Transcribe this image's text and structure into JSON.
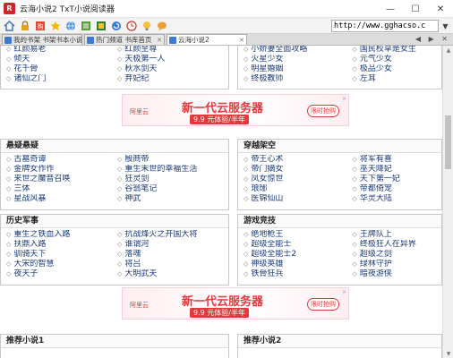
{
  "window": {
    "title": "云海小说2 TxT小说阅读器",
    "app_icon_letter": "R",
    "minimize": "—",
    "maximize": "☐",
    "close": "✕"
  },
  "toolbar": {
    "icons": [
      "home-icon",
      "lock-icon",
      "bookmark-icon",
      "star-icon",
      "globe-icon",
      "list-icon",
      "image-icon",
      "refresh-icon",
      "history-icon",
      "light-icon",
      "message-icon"
    ],
    "url": "http://www.gghacso.c",
    "go": "▼"
  },
  "tabs": [
    {
      "label": "我的书架 书架书本小说"
    },
    {
      "label": "热门频道 书库首页"
    },
    {
      "label": "云海小说2"
    }
  ],
  "tabbar_right": "◀ ▶ ✕",
  "sections": {
    "top": {
      "left": {
        "col1": [
          "红颜易老",
          "倾天",
          "花千骨",
          "诸仙之门"
        ],
        "col2": [
          "红颜至尊",
          "天极第一人",
          "秋水剑天",
          "弃妃纪"
        ]
      },
      "right": {
        "col1": [
          "小娇妻全面攻略",
          "火星少女",
          "明星婚姻",
          "终极教师"
        ],
        "col2": [
          "国民校草是女生",
          "元气少女",
          "极品少女",
          "左耳"
        ]
      }
    },
    "ad1": {
      "logo": "阿里云",
      "title": "新一代云服务器",
      "sub": "9.9 元体验/半年",
      "button": "限时抢购",
      "close": "×"
    },
    "panel_a": {
      "title": "悬疑悬疑",
      "col1": [
        "古墓奇谭",
        "金牌女作作",
        "来世之魔音召唤",
        "三体",
        "星战风暴"
      ],
      "col2": [
        "殷商帝",
        "重生末世的幸福生活",
        "狂灵剑",
        "谷翁笔记",
        "神武"
      ]
    },
    "panel_b": {
      "title": "穿越架空",
      "col1": [
        "帝王心术",
        "帝门嫡女",
        "凤女惊世",
        "琅琊",
        "医锦仙山"
      ],
      "col2": [
        "将军有喜",
        "巫天降妃",
        "天下第一妃",
        "帝都倚宠",
        "华灵大陆"
      ]
    },
    "panel_c": {
      "title": "历史军事",
      "col1": [
        "重生之铁血入路",
        "扶鼎入路",
        "驯骑天下",
        "大宋的智慧",
        "夜天子"
      ],
      "col2": [
        "抗战烽火之开国大将",
        "谁谓河",
        "落魂",
        "将吕",
        "大明武夫"
      ]
    },
    "panel_d": {
      "title": "游戏竞技",
      "col1": [
        "绝地枪王",
        "超级全能士",
        "超级全能士2",
        "神级英雄",
        "铁骨狂兵"
      ],
      "col2": [
        "王牌队上",
        "终极狂人在异界",
        "超级之剑",
        "绿林守护",
        "暗夜游侠"
      ]
    },
    "ad2": {
      "logo": "阿里云",
      "title": "新一代云服务器",
      "sub": "9.9 元体验/半年",
      "button": "限时抢购",
      "close": "×"
    },
    "bottom": {
      "left_title": "推荐小说1",
      "right_title": "推荐小说2"
    }
  }
}
